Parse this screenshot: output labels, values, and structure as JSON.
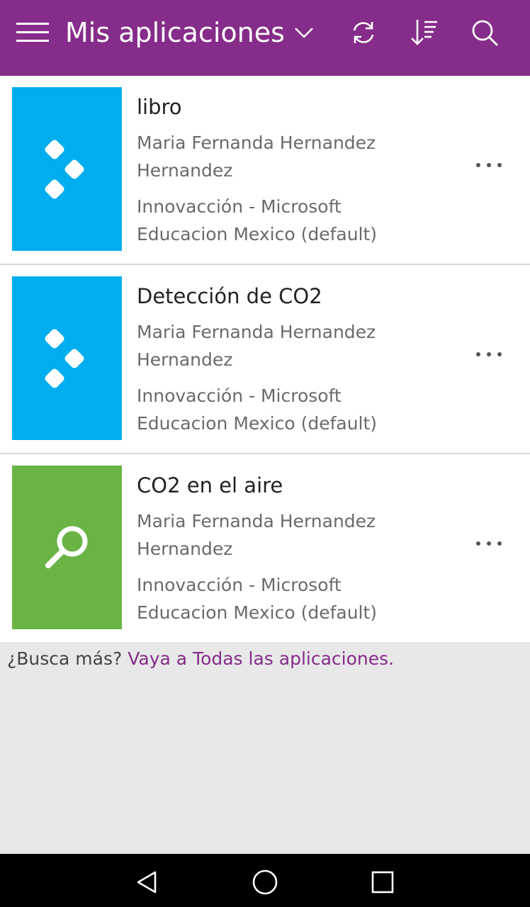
{
  "header": {
    "title": "Mis aplicaciones",
    "background_color": "#862c8a",
    "icons": [
      "hamburger-menu-icon",
      "chevron-down-icon",
      "refresh-icon",
      "sort-icon",
      "search-icon"
    ]
  },
  "apps": [
    {
      "title": "libro",
      "owner": "Maria Fernanda Hernandez Hernandez",
      "environment": "Innovacción - Microsoft Educacion Mexico (default)",
      "tile_color": "#00aeef",
      "tile_icon": "powerapps-diamonds-icon"
    },
    {
      "title": "Detección de CO2",
      "owner": "Maria Fernanda Hernandez Hernandez",
      "environment": "Innovacción - Microsoft Educacion Mexico (default)",
      "tile_color": "#00aeef",
      "tile_icon": "powerapps-diamonds-icon"
    },
    {
      "title": "CO2 en el aire",
      "owner": "Maria Fernanda Hernandez Hernandez",
      "environment": "Innovacción - Microsoft Educacion Mexico (default)",
      "tile_color": "#6ab446",
      "tile_icon": "magnifier-icon"
    }
  ],
  "footer": {
    "prompt": "¿Busca más?",
    "link": "Vaya a Todas las aplicaciones."
  },
  "navbar": {
    "icons": [
      "back-triangle-icon",
      "home-circle-icon",
      "recents-square-icon"
    ]
  }
}
